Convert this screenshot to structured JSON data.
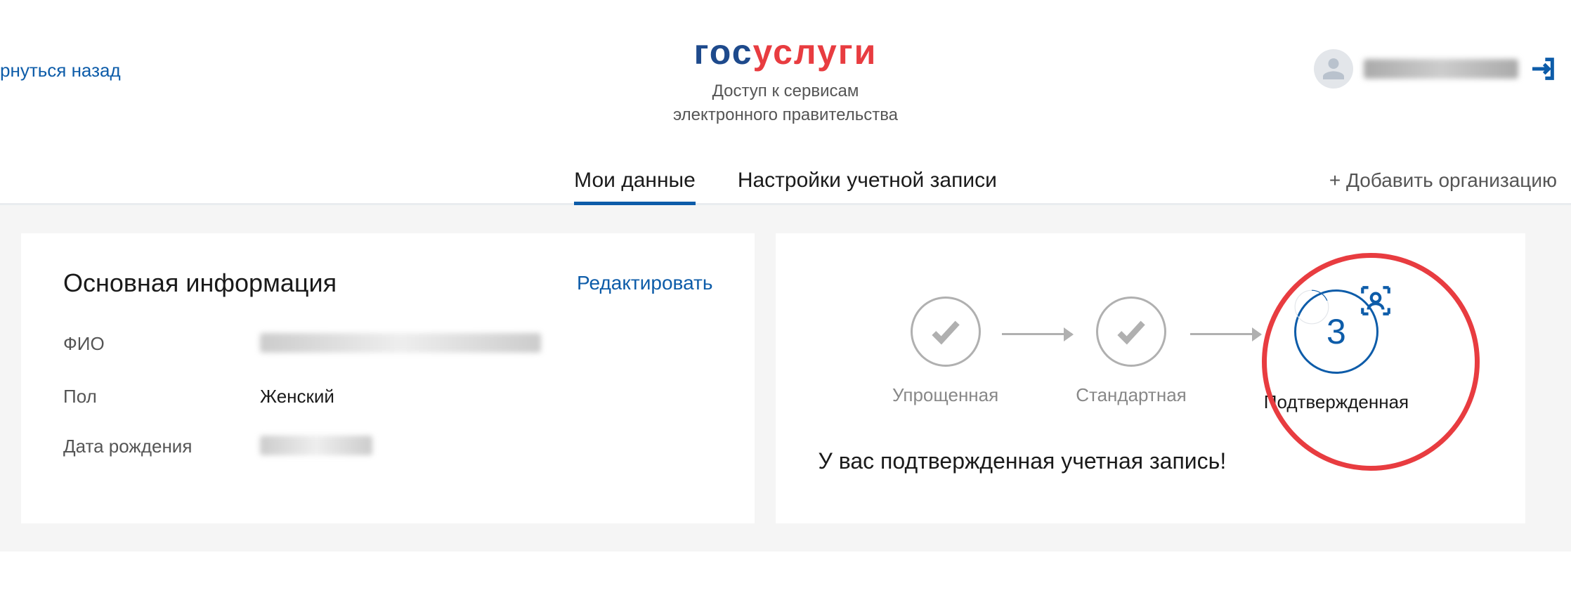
{
  "header": {
    "back_link": "рнуться назад",
    "logo_part1": "гос",
    "logo_part2": "услуги",
    "tagline_line1": "Доступ к сервисам",
    "tagline_line2": "электронного правительства"
  },
  "tabs": {
    "my_data": "Мои данные",
    "account_settings": "Настройки учетной записи",
    "add_org": "+ Добавить организацию"
  },
  "main_info": {
    "title": "Основная информация",
    "edit_label": "Редактировать",
    "fields": {
      "fio_label": "ФИО",
      "gender_label": "Пол",
      "gender_value": "Женский",
      "birthdate_label": "Дата рождения"
    }
  },
  "account_status": {
    "steps": {
      "simplified": "Упрощенная",
      "standard": "Стандартная",
      "confirmed": "Подтвержденная",
      "confirmed_number": "3"
    },
    "message": "У вас подтвержденная учетная запись!"
  }
}
